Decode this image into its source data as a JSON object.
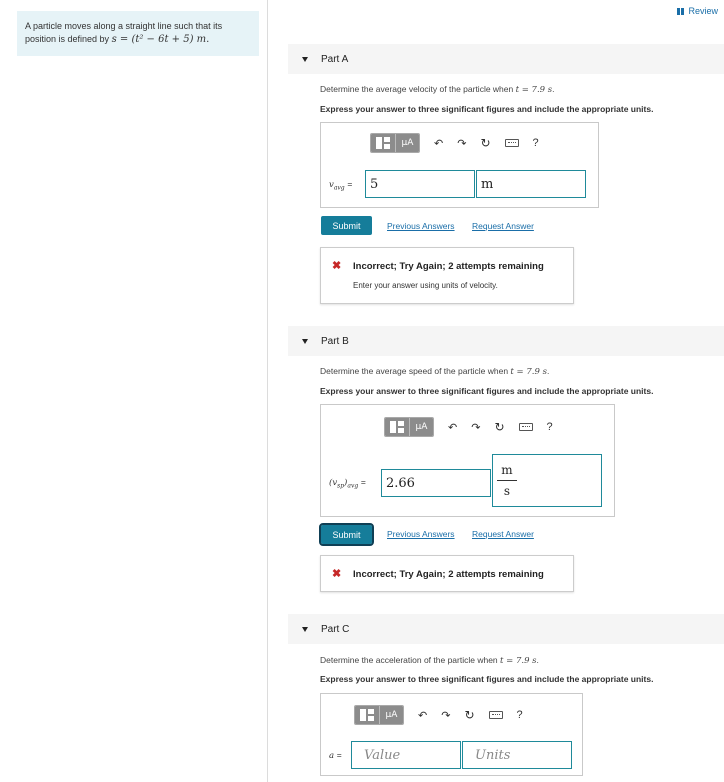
{
  "problem": {
    "text": "A particle moves along a straight line such that its position is defined by",
    "equation": "s = (t² − 6t + 5) m."
  },
  "review": {
    "label": "Review"
  },
  "toolbar": {
    "mu_label": "μA",
    "undo": "↶",
    "redo": "↷",
    "reset": "↻",
    "help": "?"
  },
  "common": {
    "instruction": "Express your answer to three significant figures and include the appropriate units.",
    "submit_label": "Submit",
    "previous_answers": "Previous Answers",
    "request_answer": "Request Answer"
  },
  "partA": {
    "title": "Part A",
    "question_prefix": "Determine the average velocity of the particle when ",
    "question_time": "t = 7.9 s",
    "question_suffix": ".",
    "var_label": "v",
    "var_sub": "avg",
    "value": "5",
    "units": "m",
    "feedback": {
      "status": "Incorrect; Try Again; 2 attempts remaining",
      "hint": "Enter your answer using units of velocity."
    }
  },
  "partB": {
    "title": "Part B",
    "question_prefix": "Determine the average speed of the particle when ",
    "question_time": "t = 7.9 s",
    "question_suffix": ".",
    "var_label": "(v",
    "var_sub": "sp",
    "var_tail": ")",
    "var_sub2": "avg",
    "value": "2.66",
    "units_num": "m",
    "units_den": "s",
    "feedback": {
      "status": "Incorrect; Try Again; 2 attempts remaining"
    }
  },
  "partC": {
    "title": "Part C",
    "question_prefix": "Determine the acceleration of the particle when ",
    "question_time": "t = 7.9 s",
    "question_suffix": ".",
    "var_label": "a",
    "value_placeholder": "Value",
    "units_placeholder": "Units"
  }
}
